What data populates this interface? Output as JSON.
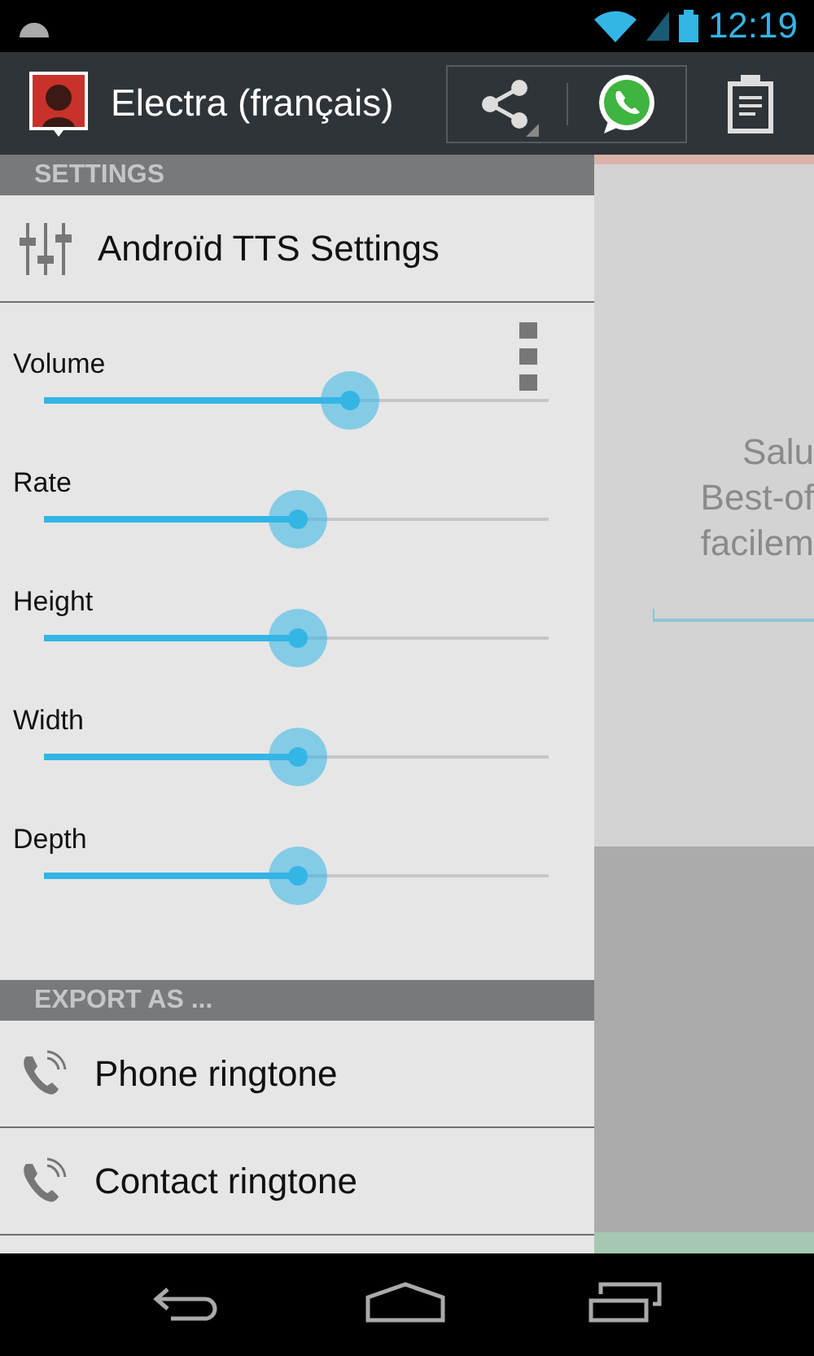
{
  "status_bar": {
    "time": "12:19"
  },
  "action_bar": {
    "title": "Electra (français)"
  },
  "drawer": {
    "settings_header": "SETTINGS",
    "tts_item": "Androïd TTS Settings",
    "sliders": [
      {
        "label": "Volume",
        "level": 0.606
      },
      {
        "label": "Rate",
        "level": 0.503
      },
      {
        "label": "Height",
        "level": 0.503
      },
      {
        "label": "Width",
        "level": 0.503
      },
      {
        "label": "Depth",
        "level": 0.503
      }
    ],
    "export_header": "EXPORT AS ...",
    "export_items": [
      "Phone ringtone",
      "Contact ringtone"
    ]
  },
  "content": {
    "lines": [
      "Salu",
      "Best-of",
      "facilem"
    ]
  }
}
